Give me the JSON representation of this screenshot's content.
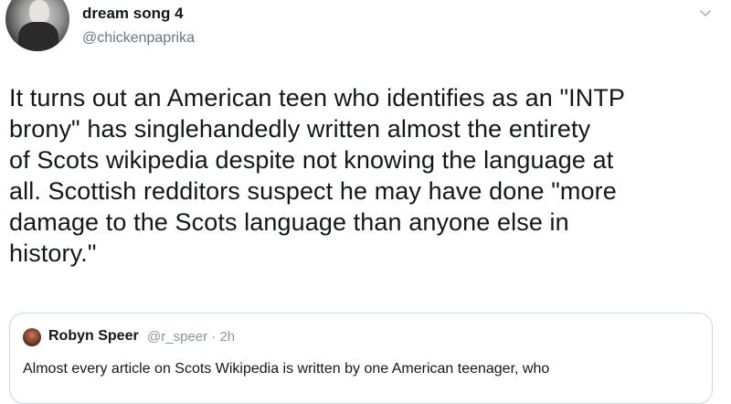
{
  "tweet": {
    "author_name": "dream song 4",
    "author_handle": "@chickenpaprika",
    "text": "It turns out an American teen who identifies as an \"INTP\nbrony\" has singlehandedly written almost the entirety\nof Scots wikipedia despite not knowing the language at\nall. Scottish redditors suspect he may have done \"more\ndamage to the Scots language than anyone else in\nhistory.\"",
    "menu_icon": "chevron-down-icon"
  },
  "quoted_tweet": {
    "author_name": "Robyn Speer",
    "author_handle": "@r_speer",
    "separator": "·",
    "time": "2h",
    "text": "Almost every article on Scots Wikipedia is written by one American teenager, who"
  }
}
